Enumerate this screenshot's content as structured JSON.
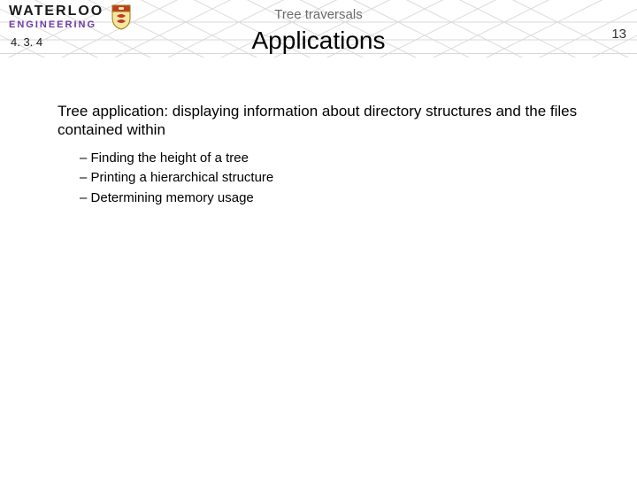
{
  "header": {
    "logo_line1": "WATERLOO",
    "logo_line2": "ENGINEERING",
    "breadcrumb": "Tree traversals",
    "page_number": "13"
  },
  "section_number": "4. 3. 4",
  "slide_title": "Applications",
  "lead_text": "Tree application:  displaying information about directory structures and the files contained within",
  "bullets": [
    "Finding the height of a tree",
    "Printing a hierarchical structure",
    "Determining memory usage"
  ]
}
